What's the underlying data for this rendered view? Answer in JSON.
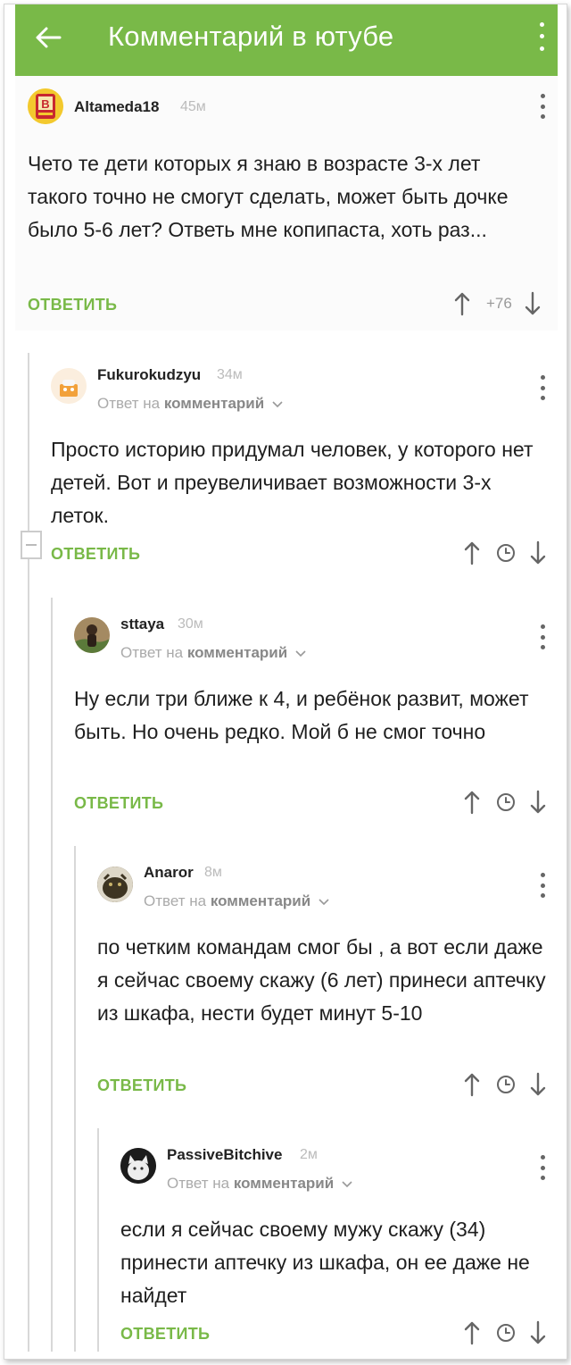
{
  "appbar": {
    "title": "Комментарий в ютубе",
    "back_icon": "arrow-left-icon",
    "menu_icon": "more-vert-icon",
    "color": "#79b948"
  },
  "comments": [
    {
      "user": "Altameda18",
      "time": "45м",
      "text": "Чето те дети которых я знаю в возрасте 3-х лет такого точно не смогут сделать, может быть дочке было 5-6 лет? Ответь мне копипаста, хоть раз...",
      "reply_label": "ОТВЕТИТЬ",
      "score": "+76"
    },
    {
      "user": "Fukurokudzyu",
      "time": "34м",
      "reply_to_prefix": "Ответ на",
      "reply_to_link": "комментарий",
      "text": "Просто историю придумал человек, у которого нет детей. Вот и преувеличивает возможности 3-х леток.",
      "reply_label": "ОТВЕТИТЬ"
    },
    {
      "user": "sttaya",
      "time": "30м",
      "reply_to_prefix": "Ответ на",
      "reply_to_link": "комментарий",
      "text": "Ну если три ближе к 4, и ребёнок развит, может быть.  Но очень редко. Мой б не смог точно",
      "reply_label": "ОТВЕТИТЬ"
    },
    {
      "user": "Anaror",
      "time": "8м",
      "reply_to_prefix": "Ответ на",
      "reply_to_link": "комментарий",
      "text": "по четким командам смог бы , а вот если даже я сейчас своему скажу (6 лет) принеси аптечку из шкафа, нести будет минут 5-10",
      "reply_label": "ОТВЕТИТЬ"
    },
    {
      "user": "PassiveBitchive",
      "time": "2м",
      "reply_to_prefix": "Ответ на",
      "reply_to_link": "комментарий",
      "text": "если я сейчас своему мужу скажу (34) принести аптечку из шкафа, он ее даже не найдет",
      "reply_label": "ОТВЕТИТЬ"
    }
  ],
  "colors": {
    "accent": "#79b948",
    "muted": "#aaaaaa"
  }
}
